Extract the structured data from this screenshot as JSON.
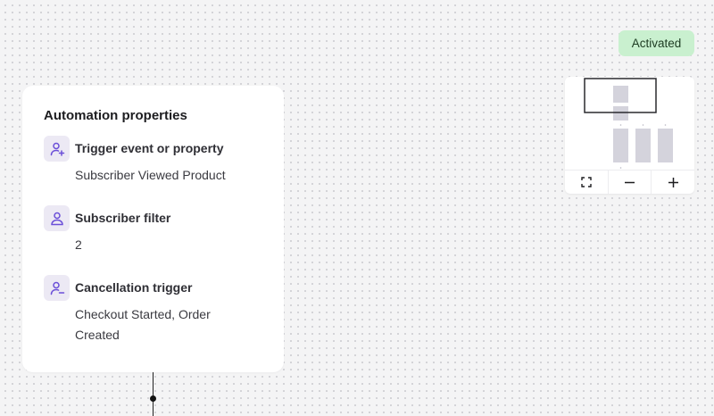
{
  "status": {
    "label": "Activated",
    "color": "#c9f0cf"
  },
  "properties": {
    "title": "Automation properties",
    "items": [
      {
        "icon": "user-plus-icon",
        "label": "Trigger event or property",
        "value": "Subscriber Viewed Product"
      },
      {
        "icon": "user-icon",
        "label": "Subscriber filter",
        "value": "2"
      },
      {
        "icon": "user-minus-icon",
        "label": "Cancellation trigger",
        "value": "Checkout Started, Order Created"
      }
    ]
  },
  "minimap": {
    "controls": [
      "fit-view-icon",
      "zoom-out-icon",
      "zoom-in-icon"
    ]
  },
  "colors": {
    "accent": "#6b4fd8",
    "icon_bg": "#ece9f4"
  }
}
